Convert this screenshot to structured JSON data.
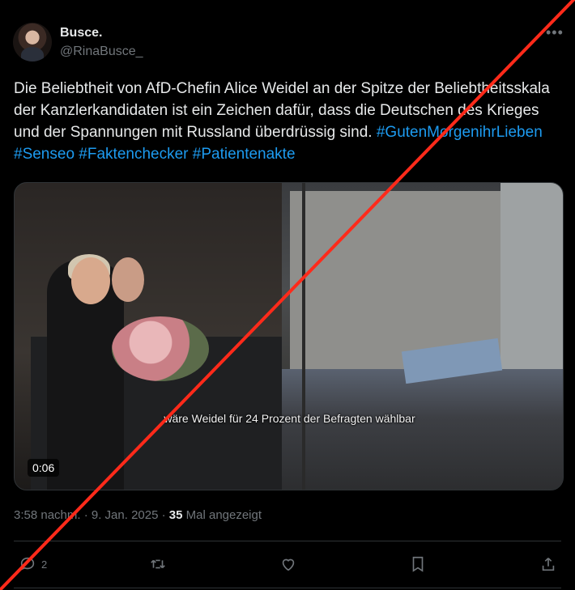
{
  "author": {
    "display_name": "Busce.",
    "handle": "@RinaBusce_"
  },
  "tweet": {
    "text_plain": "Die Beliebtheit von AfD-Chefin Alice Weidel an der Spitze der Beliebtheitsskala der Kanzlerkandidaten ist ein Zeichen dafür, dass die Deutschen des Krieges und der Spannungen mit Russland überdrüssig sind.",
    "hashtags": [
      "#GutenMorgenihrLieben",
      "#Senseo",
      "#Faktenchecker",
      "#Patientenakte"
    ]
  },
  "media": {
    "subtitle": "wäre Weidel für 24 Prozent der Befragten wählbar",
    "duration": "0:06"
  },
  "meta": {
    "time_date": "3:58 nachm. · 9. Jan. 2025 · ",
    "views_count": "35",
    "views_label": " Mal angezeigt"
  },
  "actions": {
    "reply_count": "2"
  },
  "overlay": {
    "slash_color": "#ff2a1a"
  },
  "icons": [
    "more-icon",
    "reply-icon",
    "retweet-icon",
    "like-icon",
    "bookmark-icon",
    "share-icon"
  ]
}
